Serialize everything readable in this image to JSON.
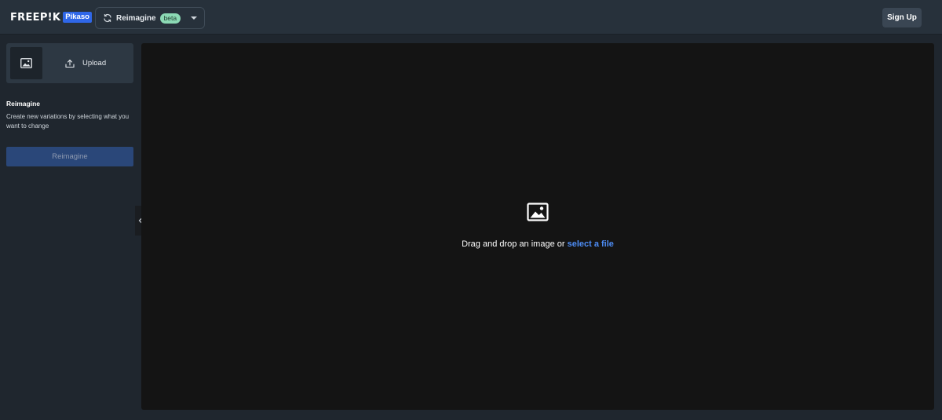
{
  "header": {
    "logo_text": "FREEP!K",
    "logo_badge": "Pikaso",
    "tool_selector": {
      "icon": "refresh-icon",
      "label": "Reimagine",
      "badge": "beta"
    },
    "signup_label": "Sign Up"
  },
  "sidebar": {
    "thumbnail_icon": "image-icon",
    "upload_label": "Upload",
    "section_title": "Reimagine",
    "section_description": "Create new variations by selecting what you want to change",
    "action_button_label": "Reimagine"
  },
  "canvas": {
    "drop_icon": "image-icon",
    "drop_text": "Drag and drop an image or ",
    "drop_link": "select a file"
  },
  "colors": {
    "accent": "#2f67e8",
    "link": "#4d8cf5",
    "badge_beta": "#8bd9b4",
    "action_button": "#2a4779"
  }
}
